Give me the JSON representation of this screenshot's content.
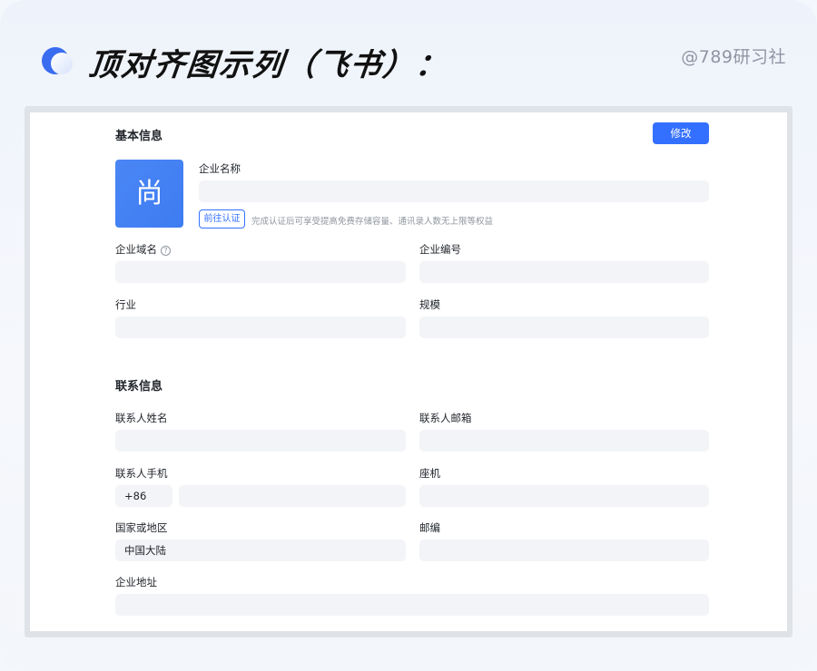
{
  "hero": {
    "title": "顶对齐图示列（飞书）：",
    "watermark": "@789研习社"
  },
  "basic": {
    "section_title": "基本信息",
    "edit_label": "修改",
    "avatar_char": "尚",
    "company_name_label": "企业名称",
    "company_name_value": "",
    "verify_label": "前往认证",
    "verify_hint": "完成认证后可享受提高免费存储容量、通讯录人数无上限等权益",
    "domain_label": "企业域名",
    "domain_value": "",
    "number_label": "企业编号",
    "number_value": "",
    "industry_label": "行业",
    "industry_value": "",
    "scale_label": "规模",
    "scale_value": ""
  },
  "contact": {
    "section_title": "联系信息",
    "name_label": "联系人姓名",
    "name_value": "",
    "email_label": "联系人邮箱",
    "email_value": "",
    "phone_label": "联系人手机",
    "phone_code": "+86",
    "phone_value": "",
    "landline_label": "座机",
    "landline_value": "",
    "region_label": "国家或地区",
    "region_value": "中国大陆",
    "postcode_label": "邮编",
    "postcode_value": "",
    "address_label": "企业地址",
    "address_value": ""
  }
}
